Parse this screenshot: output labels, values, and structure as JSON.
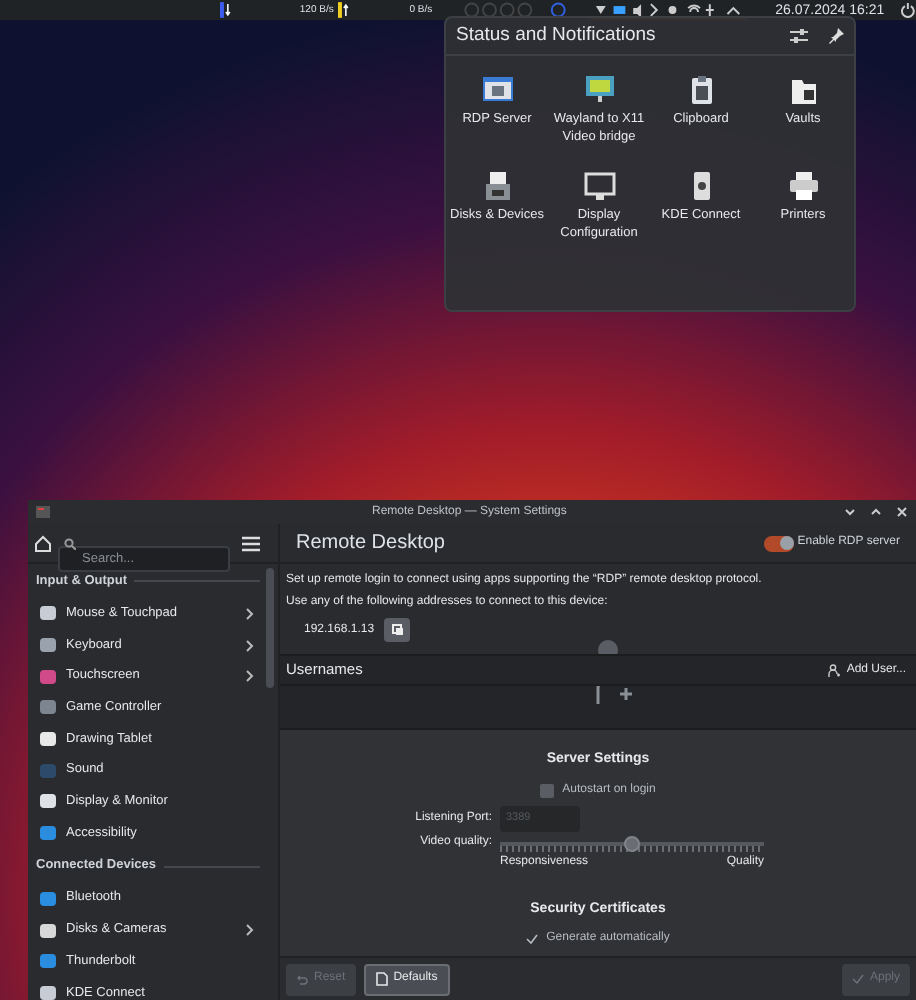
{
  "panel": {
    "download_rate": "120 B/s",
    "upload_rate": "0 B/s",
    "clock": "26.07.2024 16:21"
  },
  "popup": {
    "title": "Status and Notifications",
    "items": [
      {
        "label": "RDP Server",
        "kind": "rdp"
      },
      {
        "label": "Wayland to X11 Video bridge",
        "kind": "monitor"
      },
      {
        "label": "Clipboard",
        "kind": "clipboard"
      },
      {
        "label": "Vaults",
        "kind": "vault"
      },
      {
        "label": "Disks & Devices",
        "kind": "disk"
      },
      {
        "label": "Display Configuration",
        "kind": "display"
      },
      {
        "label": "KDE Connect",
        "kind": "phone"
      },
      {
        "label": "Printers",
        "kind": "printer"
      }
    ]
  },
  "window": {
    "title": "Remote Desktop — System Settings"
  },
  "sidebar": {
    "search": {
      "placeholder": "Search..."
    },
    "sections": [
      {
        "title": "Input & Output",
        "items": [
          {
            "label": "Mouse & Touchpad",
            "has_children": true,
            "color": "#c8ccd4"
          },
          {
            "label": "Keyboard",
            "has_children": true,
            "color": "#9aa3ad"
          },
          {
            "label": "Touchscreen",
            "has_children": true,
            "color": "#d04a8a"
          },
          {
            "label": "Game Controller",
            "has_children": false,
            "color": "#7d8590"
          },
          {
            "label": "Drawing Tablet",
            "has_children": false,
            "color": "#e8e8e8"
          },
          {
            "label": "Sound",
            "has_children": false,
            "color": "#2c4a6a"
          },
          {
            "label": "Display & Monitor",
            "has_children": false,
            "color": "#dfe3e8"
          },
          {
            "label": "Accessibility",
            "has_children": false,
            "color": "#2a8de0"
          }
        ]
      },
      {
        "title": "Connected Devices",
        "items": [
          {
            "label": "Bluetooth",
            "has_children": false,
            "color": "#2a8de0"
          },
          {
            "label": "Disks & Cameras",
            "has_children": true,
            "color": "#d8d8d8"
          },
          {
            "label": "Thunderbolt",
            "has_children": false,
            "color": "#2a8de0"
          },
          {
            "label": "KDE Connect",
            "has_children": false,
            "color": "#c8ccd4"
          }
        ]
      }
    ]
  },
  "page": {
    "title": "Remote Desktop",
    "enable_toggle": {
      "label": "Enable RDP server",
      "on": true
    },
    "description": "Set up remote login to connect using apps supporting the “RDP” remote desktop protocol.",
    "address_hint": "Use any of the following addresses to connect to this device:",
    "address": "192.168.1.13",
    "usernames": {
      "title": "Usernames",
      "add_button": "Add User..."
    },
    "server_settings": {
      "title": "Server Settings",
      "autostart": {
        "label": "Autostart on login",
        "checked": false
      },
      "port": {
        "label": "Listening Port:",
        "value": "3389",
        "disabled": true
      },
      "video_quality": {
        "label": "Video quality:",
        "level": 0.5,
        "min_label": "Responsiveness",
        "max_label": "Quality"
      }
    },
    "certificates": {
      "title": "Security Certificates",
      "generate": {
        "label": "Generate automatically",
        "checked": true
      }
    }
  },
  "footer": {
    "buttons": [
      {
        "label": "Reset",
        "kind": "reset",
        "disabled": true
      },
      {
        "label": "Defaults",
        "kind": "defaults",
        "disabled": false
      },
      {
        "label": "Apply",
        "kind": "apply",
        "disabled": true
      }
    ]
  }
}
